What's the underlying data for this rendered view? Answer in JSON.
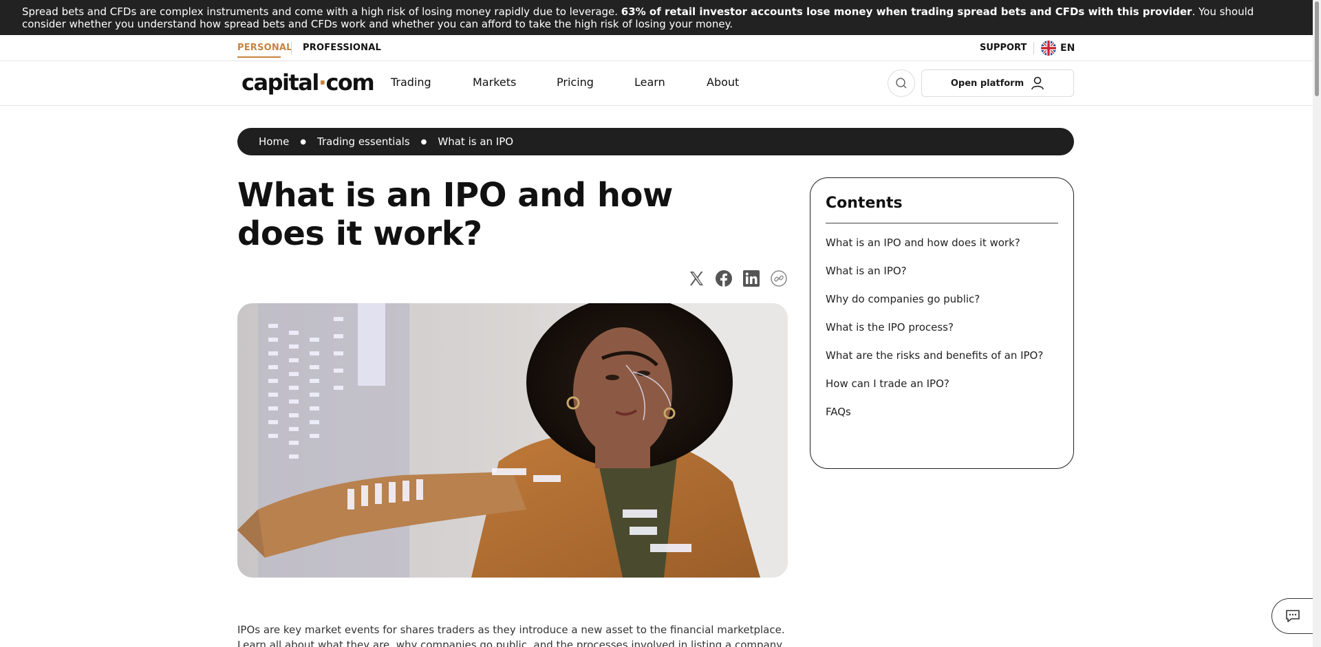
{
  "risk_banner": {
    "text_before": "Spread bets and CFDs are complex instruments and come with a high risk of losing money rapidly due to leverage. ",
    "text_bold": "63% of retail investor accounts lose money when trading spread bets and CFDs with this provider",
    "text_after": ". You should consider whether you understand how spread bets and CFDs work and whether you can afford to take the high risk of losing your money."
  },
  "segments": {
    "personal": "PERSONAL",
    "professional": "PROFESSIONAL",
    "support": "SUPPORT",
    "language": "EN",
    "language_icon": "uk-flag-icon"
  },
  "nav": {
    "logo_left": "capital",
    "logo_dot": "·",
    "logo_right": "com",
    "items": [
      "Trading",
      "Markets",
      "Pricing",
      "Learn",
      "About"
    ],
    "open_platform": "Open platform"
  },
  "breadcrumb": [
    "Home",
    "Trading essentials",
    "What is an IPO"
  ],
  "article": {
    "title": "What is an IPO and how does it work?",
    "intro": "IPOs are key market events for shares traders as they introduce a new asset to the financial marketplace. Learn all about what they are, why companies go public, and the processes involved in listing a company."
  },
  "share_icons": [
    "x-icon",
    "facebook-icon",
    "linkedin-icon",
    "copy-link-icon"
  ],
  "toc": {
    "title": "Contents",
    "items": [
      "What is an IPO and how does it work?",
      "What is an IPO?",
      "Why do companies go public?",
      "What is the IPO process?",
      "What are the risks and benefits of an IPO?",
      "How can I trade an IPO?",
      "FAQs"
    ]
  },
  "colors": {
    "accent": "#c6843f",
    "dark": "#1f1f1f"
  }
}
